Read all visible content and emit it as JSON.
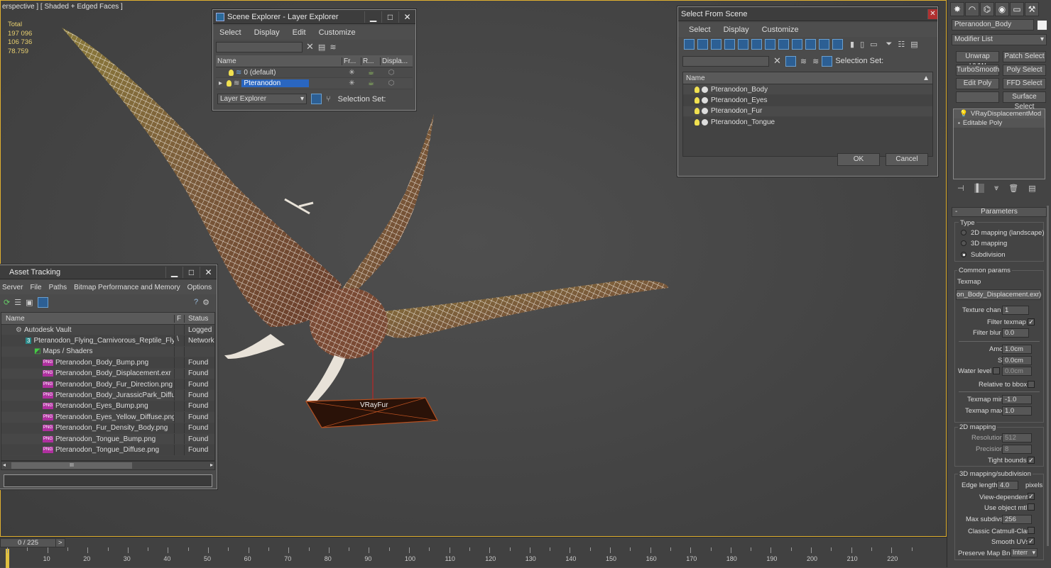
{
  "viewport": {
    "label": "erspective ] [ Shaded + Edged Faces ]",
    "stats": [
      "Total",
      "197 096",
      "106 736",
      "",
      "78.759"
    ],
    "object_label": "VRayFur"
  },
  "scene_explorer": {
    "title": "Scene Explorer - Layer Explorer",
    "menu": [
      "Select",
      "Display",
      "Edit",
      "Customize"
    ],
    "columns": [
      "Name",
      "Fr...",
      "R...",
      "Displa..."
    ],
    "rows": [
      {
        "name": "0 (default)"
      },
      {
        "name": "Pteranodon"
      }
    ],
    "mode": "Layer Explorer",
    "selection_set": "Selection Set:"
  },
  "select_from_scene": {
    "title": "Select From Scene",
    "menu": [
      "Select",
      "Display",
      "Customize"
    ],
    "selection_set": "Selection Set:",
    "column": "Name",
    "items": [
      "Pteranodon_Body",
      "Pteranodon_Eyes",
      "Pteranodon_Fur",
      "Pteranodon_Tongue"
    ],
    "ok": "OK",
    "cancel": "Cancel"
  },
  "asset_tracking": {
    "title": "Asset Tracking",
    "menu": [
      "Server",
      "File",
      "Paths",
      "Bitmap Performance and Memory",
      "Options"
    ],
    "columns": [
      "Name",
      "F",
      "Status"
    ],
    "rows": [
      {
        "name": "Autodesk Vault",
        "f": "",
        "status": "Logged",
        "indent": 20
      },
      {
        "name": "Pteranodon_Flying_Carnivorous_Reptile_Flyi...",
        "f": "\\",
        "status": "Network",
        "indent": 34
      },
      {
        "name": "Maps / Shaders",
        "f": "",
        "status": "",
        "indent": 46
      },
      {
        "name": "Pteranodon_Body_Bump.png",
        "f": "",
        "status": "Found",
        "indent": 58
      },
      {
        "name": "Pteranodon_Body_Displacement.exr",
        "f": "",
        "status": "Found",
        "indent": 58
      },
      {
        "name": "Pteranodon_Body_Fur_Direction.png",
        "f": "",
        "status": "Found",
        "indent": 58
      },
      {
        "name": "Pteranodon_Body_JurassicPark_Diffus...",
        "f": "",
        "status": "Found",
        "indent": 58
      },
      {
        "name": "Pteranodon_Eyes_Bump.png",
        "f": "",
        "status": "Found",
        "indent": 58
      },
      {
        "name": "Pteranodon_Eyes_Yellow_Diffuse.png",
        "f": "",
        "status": "Found",
        "indent": 58
      },
      {
        "name": "Pteranodon_Fur_Density_Body.png",
        "f": "",
        "status": "Found",
        "indent": 58
      },
      {
        "name": "Pteranodon_Tongue_Bump.png",
        "f": "",
        "status": "Found",
        "indent": 58
      },
      {
        "name": "Pteranodon_Tongue_Diffuse.png",
        "f": "",
        "status": "Found",
        "indent": 58
      }
    ],
    "scroll_label": "III"
  },
  "command_panel": {
    "object_name": "Pteranodon_Body",
    "modifier_list": "Modifier List",
    "buttons": [
      "Unwrap UVW",
      "Patch Select",
      "TurboSmooth",
      "Poly Select",
      "Edit Poly",
      "FFD Select",
      "",
      "Surface Select"
    ],
    "stack": [
      "VRayDisplacementMod",
      "Editable Poly"
    ],
    "rollout": "Parameters",
    "type_label": "Type",
    "type_options": [
      "2D mapping (landscape)",
      "3D mapping",
      "Subdivision"
    ],
    "common_label": "Common params",
    "texmap_label": "Texmap",
    "texmap_value": "on_Body_Displacement.exr)",
    "texture_chan_label": "Texture chan",
    "texture_chan": "1",
    "filter_texmap_label": "Filter texmap",
    "filter_blur_label": "Filter blur",
    "filter_blur": "0.0",
    "amount_label": "Amount",
    "amount": "1.0cm",
    "shift_label": "Shift",
    "shift": "0.0cm",
    "water_label": "Water level",
    "water": "0.0cm",
    "relbbox_label": "Relative to bbox",
    "texmin_label": "Texmap min",
    "texmin": "-1.0",
    "texmax_label": "Texmap max",
    "texmax": "1.0",
    "map2d_label": "2D mapping",
    "resolution_label": "Resolution",
    "resolution": "512",
    "precision_label": "Precision",
    "precision": "8",
    "tight_label": "Tight bounds",
    "map3d_label": "3D mapping/subdivision",
    "edge_label": "Edge length",
    "edge": "4.0",
    "pixels": "pixels",
    "viewdep_label": "View-dependent",
    "useobj_label": "Use object mtl",
    "maxsub_label": "Max subdivs",
    "maxsub": "256",
    "catmull_label": "Classic Catmull-Clark",
    "smoothuv_label": "Smooth UVs",
    "preserve_label": "Preserve Map Bnd",
    "preserve": "Interr"
  },
  "timeline": {
    "frame": "0 / 225",
    "ticks": [
      "10",
      "20",
      "30",
      "40",
      "50",
      "60",
      "70",
      "80",
      "90",
      "100",
      "110",
      "120",
      "130",
      "140",
      "150",
      "160",
      "170",
      "180",
      "190",
      "200",
      "210",
      "220"
    ]
  }
}
